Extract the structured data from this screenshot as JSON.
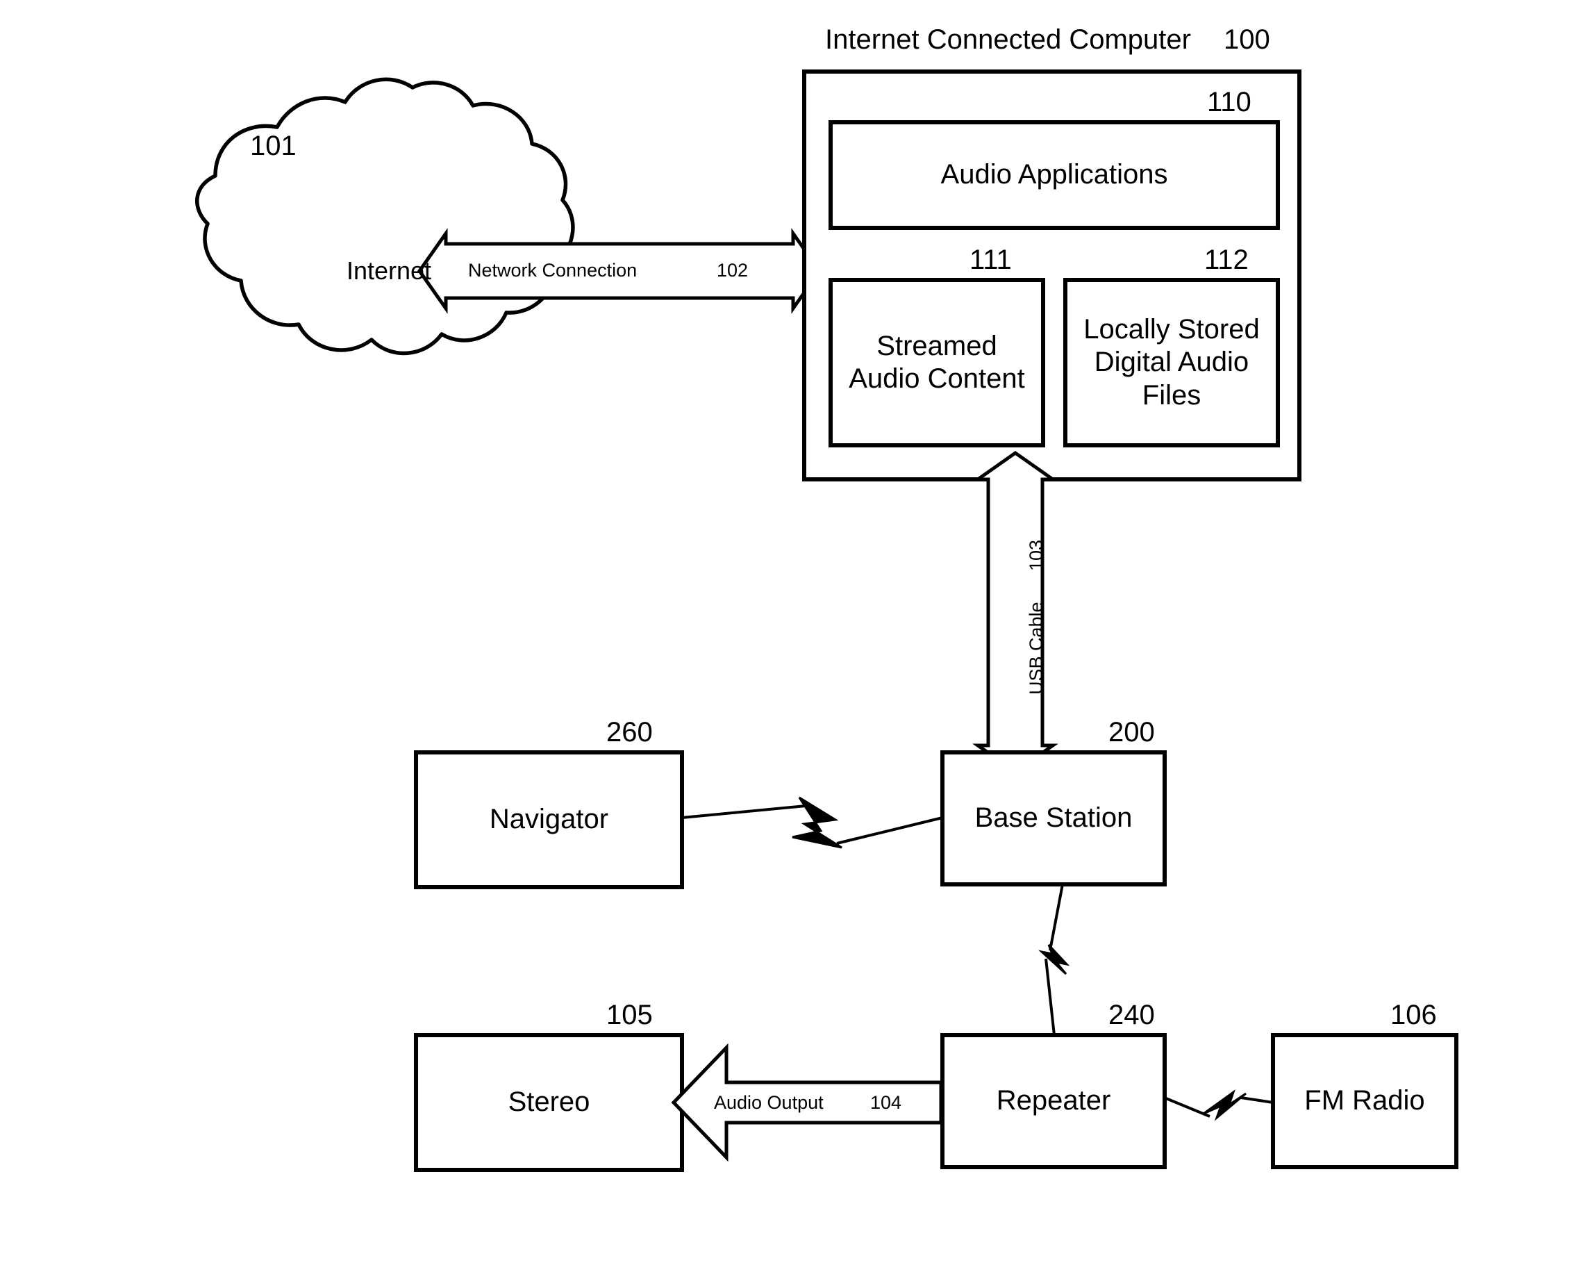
{
  "figure": {
    "type": "patent-block-diagram",
    "background_color": "#ffffff",
    "stroke_color": "#000000"
  },
  "computer": {
    "title": "Internet Connected Computer",
    "ref": "100",
    "modules": [
      {
        "label": "Audio Applications",
        "ref": "110"
      },
      {
        "label": "Streamed\nAudio Content",
        "ref": "111"
      },
      {
        "label": "Locally Stored\nDigital Audio\nFiles",
        "ref": "112"
      }
    ]
  },
  "cloud": {
    "label": "Internet",
    "ref": "101"
  },
  "connections": {
    "network": {
      "label": "Network Connection",
      "ref": "102"
    },
    "usb": {
      "label": "USB Cable",
      "ref": "103"
    },
    "audio_output": {
      "label": "Audio Output",
      "ref": "104"
    }
  },
  "nodes": [
    {
      "label": "Navigator",
      "ref": "260"
    },
    {
      "label": "Base Station",
      "ref": "200"
    },
    {
      "label": "Stereo",
      "ref": "105"
    },
    {
      "label": "Repeater",
      "ref": "240"
    },
    {
      "label": "FM Radio",
      "ref": "106"
    }
  ]
}
